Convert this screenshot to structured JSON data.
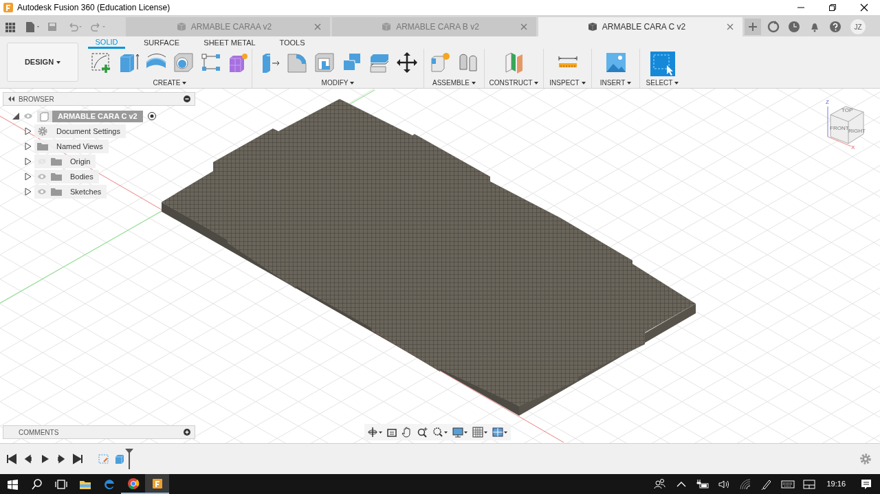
{
  "window": {
    "title": "Autodesk Fusion 360 (Education License)"
  },
  "tabs": [
    {
      "label": "ARMABLE CARAA v2",
      "selected": false
    },
    {
      "label": "ARMABLE CARA B v2",
      "selected": false
    },
    {
      "label": "ARMABLE CARA C v2",
      "selected": true
    }
  ],
  "account": {
    "initials": "JZ"
  },
  "workspace": {
    "label": "DESIGN"
  },
  "toolbar_tabs": [
    {
      "label": "SOLID",
      "selected": true
    },
    {
      "label": "SURFACE",
      "selected": false
    },
    {
      "label": "SHEET METAL",
      "selected": false
    },
    {
      "label": "TOOLS",
      "selected": false
    }
  ],
  "tool_groups": [
    {
      "label": "CREATE",
      "kind": "create"
    },
    {
      "label": "MODIFY",
      "kind": "modify"
    },
    {
      "label": "ASSEMBLE",
      "kind": "assemble"
    },
    {
      "label": "CONSTRUCT",
      "kind": "construct"
    },
    {
      "label": "INSPECT",
      "kind": "inspect"
    },
    {
      "label": "INSERT",
      "kind": "insert"
    },
    {
      "label": "SELECT",
      "kind": "select"
    }
  ],
  "browser": {
    "title": "BROWSER",
    "root": {
      "label": "ARMABLE CARA C v2",
      "visible": true
    },
    "items": [
      {
        "label": "Document Settings",
        "kind": "settings"
      },
      {
        "label": "Named Views",
        "kind": "folder"
      },
      {
        "label": "Origin",
        "kind": "folder",
        "visible": false
      },
      {
        "label": "Bodies",
        "kind": "folder",
        "visible": true
      },
      {
        "label": "Sketches",
        "kind": "folder",
        "visible": true
      }
    ]
  },
  "view_cube": {
    "faces": [
      "TOP",
      "FRONT",
      "RIGHT"
    ],
    "axes": [
      "Z",
      "X"
    ]
  },
  "comments": {
    "title": "COMMENTS"
  },
  "taskbar": {
    "clock": "19:16"
  }
}
